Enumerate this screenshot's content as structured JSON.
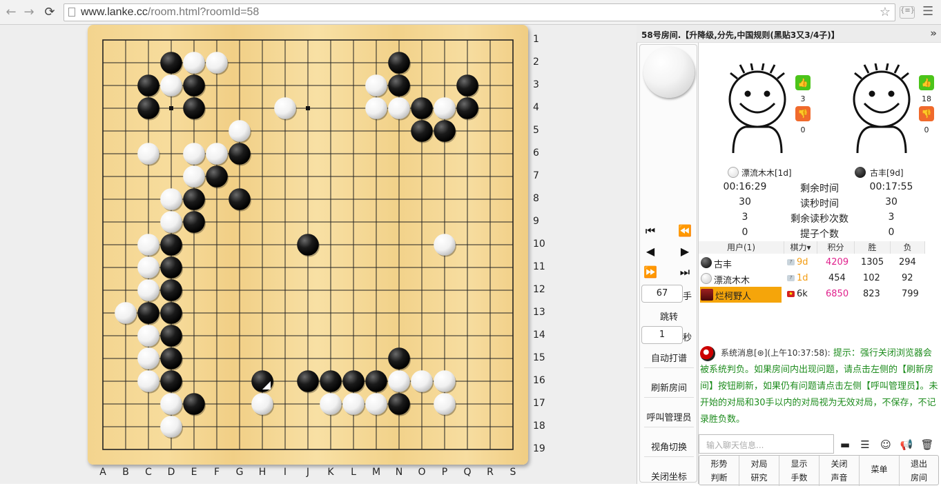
{
  "browser": {
    "url_host": "www.lanke.cc",
    "url_path": "/room.html?roomId=58",
    "back_icon": "←",
    "fwd_icon": "→",
    "reload_icon": "⟳"
  },
  "board": {
    "row_labels": [
      "1",
      "2",
      "3",
      "4",
      "5",
      "6",
      "7",
      "8",
      "9",
      "10",
      "11",
      "12",
      "13",
      "14",
      "15",
      "16",
      "17",
      "18",
      "19"
    ],
    "col_labels": [
      "A",
      "B",
      "C",
      "D",
      "E",
      "F",
      "G",
      "H",
      "I",
      "J",
      "K",
      "L",
      "M",
      "N",
      "O",
      "P",
      "Q",
      "R",
      "S"
    ],
    "black": [
      "D2",
      "N2",
      "C3",
      "E3",
      "N3",
      "Q3",
      "C4",
      "E4",
      "O4",
      "Q4",
      "O5",
      "P5",
      "G6",
      "F7",
      "E8",
      "G8",
      "E9",
      "D10",
      "J10",
      "D11",
      "D12",
      "C13",
      "D13",
      "D14",
      "D15",
      "N15",
      "D16",
      "H16",
      "J16",
      "K16",
      "L16",
      "M16",
      "E17",
      "N17"
    ],
    "white": [
      "E2",
      "F2",
      "D3",
      "M3",
      "I4",
      "M4",
      "N4",
      "P4",
      "G5",
      "C6",
      "E6",
      "F6",
      "E7",
      "D8",
      "D9",
      "C10",
      "P10",
      "C11",
      "C12",
      "B13",
      "C14",
      "C15",
      "C16",
      "N16",
      "O16",
      "P16",
      "D17",
      "H17",
      "K17",
      "L17",
      "M17",
      "P17",
      "D18"
    ],
    "last_move": "H16"
  },
  "controls": {
    "move_number": "67",
    "move_unit": "手",
    "jump": "跳转",
    "seconds": "1",
    "seconds_unit": "秒",
    "auto_play": "自动打谱",
    "refresh_room": "刷新房间",
    "call_admin": "呼叫管理员",
    "switch_view": "视角切换",
    "close_coords": "关闭坐标"
  },
  "room": {
    "title": "58号房间.【升降级,分先,中国规则(黑贴3又3/4子)】",
    "collapse": "»"
  },
  "players": {
    "white": {
      "name": "漂流木木[1d]",
      "likes": "3",
      "dislikes": "0",
      "remain_time": "00:16:29",
      "byo_time": "30",
      "byo_left": "3",
      "captures": "0"
    },
    "black": {
      "name": "古丰[9d]",
      "likes": "18",
      "dislikes": "0",
      "remain_time": "00:17:55",
      "byo_time": "30",
      "byo_left": "3",
      "captures": "0"
    }
  },
  "stats_labels": [
    "剩余时间",
    "读秒时间",
    "剩余读秒次数",
    "提子个数"
  ],
  "users": {
    "headers": [
      "用户(1)",
      "棋力▾",
      "积分",
      "胜",
      "负"
    ],
    "rows": [
      {
        "name": "古丰",
        "rank": "9d",
        "score": "4209",
        "win": "1305",
        "lose": "294"
      },
      {
        "name": "漂流木木",
        "rank": "1d",
        "score": "454",
        "win": "102",
        "lose": "92"
      },
      {
        "name": "烂柯野人",
        "rank": "6k",
        "score": "6850",
        "win": "823",
        "lose": "799"
      }
    ]
  },
  "chat": {
    "sys_label": "系统消息[⊛](上午10:37:58):",
    "message": "提示：强行关闭浏览器会被系统判负。如果房间内出现问题，请点击左侧的【刷新房间】按钮刷新，如果仍有问题请点击左侧【呼叫管理员】。未开始的对局和30手以内的对局视为无效对局，不保存，不记录胜负数。",
    "placeholder": "输入聊天信息..."
  },
  "bottom": [
    {
      "l1": "形势",
      "l2": "判断"
    },
    {
      "l1": "对局",
      "l2": "研究"
    },
    {
      "l1": "显示",
      "l2": "手数"
    },
    {
      "l1": "关闭",
      "l2": "声音"
    },
    {
      "l1": "菜单",
      "l2": ""
    },
    {
      "l1": "退出",
      "l2": "房间"
    }
  ],
  "colors": {
    "accent_orange": "#f39c12",
    "pink": "#e0208c",
    "green_chat": "#1e8c1e",
    "like": "#4cc41a",
    "dislike": "#f06a2c"
  }
}
